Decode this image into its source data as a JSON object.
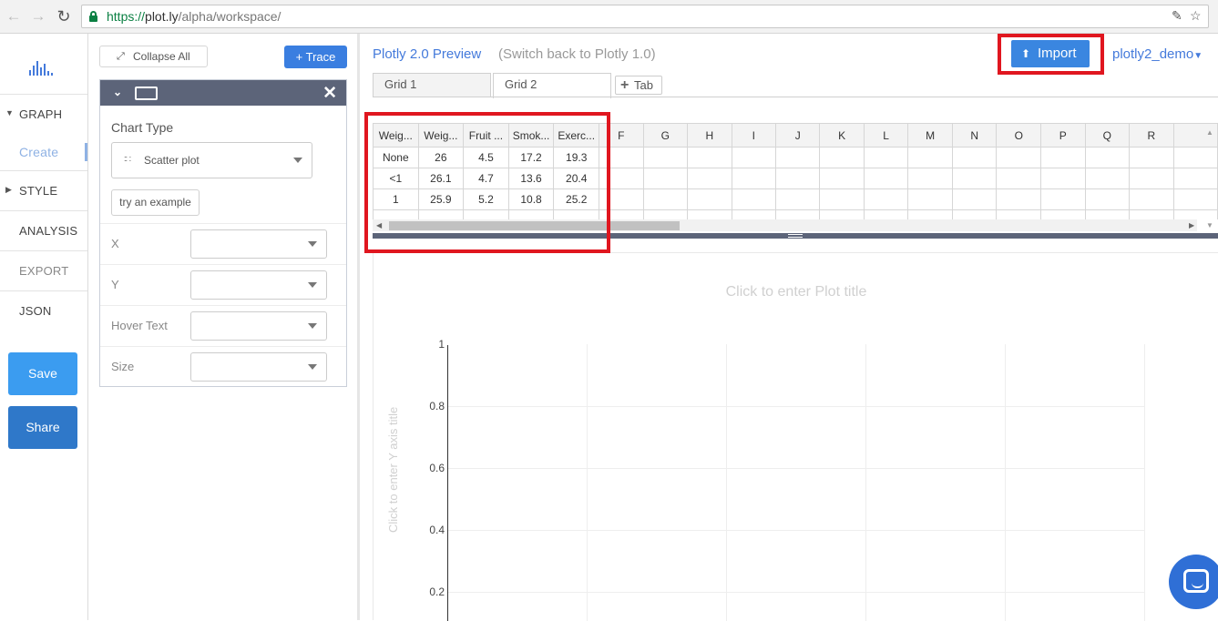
{
  "browser": {
    "url_scheme": "https://",
    "url_host": "plot.ly",
    "url_path": "/alpha/workspace/"
  },
  "leftnav": {
    "items": [
      {
        "label": "GRAPH"
      },
      {
        "label": "Create"
      },
      {
        "label": "STYLE"
      },
      {
        "label": "ANALYSIS"
      },
      {
        "label": "EXPORT"
      },
      {
        "label": "JSON"
      }
    ],
    "save_label": "Save",
    "share_label": "Share"
  },
  "panel": {
    "collapse_label": "Collapse All",
    "add_trace_label": "+ Trace",
    "chart_type_label": "Chart Type",
    "chart_type_value": "Scatter plot",
    "try_example_label": "try an example",
    "attributes": [
      {
        "label": "X",
        "value": ""
      },
      {
        "label": "Y",
        "value": ""
      },
      {
        "label": "Hover Text",
        "value": ""
      },
      {
        "label": "Size",
        "value": ""
      }
    ]
  },
  "workspace": {
    "preview_title": "Plotly 2.0 Preview",
    "switch_link": "(Switch back to Plotly 1.0)",
    "import_label": "Import",
    "user_name": "plotly2_demo",
    "tabs": [
      {
        "label": "Grid 1"
      },
      {
        "label": "Grid 2"
      }
    ],
    "add_tab_label": "Tab"
  },
  "grid": {
    "columns": [
      "Weig...",
      "Weig...",
      "Fruit ...",
      "Smok...",
      "Exerc...",
      "F",
      "G",
      "H",
      "I",
      "J",
      "K",
      "L",
      "M",
      "N",
      "O",
      "P",
      "Q",
      "R",
      ""
    ],
    "rows": [
      [
        "None",
        "26",
        "4.5",
        "17.2",
        "19.3"
      ],
      [
        "<1",
        "26.1",
        "4.7",
        "13.6",
        "20.4"
      ],
      [
        "1",
        "25.9",
        "5.2",
        "10.8",
        "25.2"
      ]
    ]
  },
  "plot": {
    "title_placeholder": "Click to enter Plot title",
    "y_title_placeholder": "Click to enter Y axis title",
    "y_ticks": [
      "1",
      "0.8",
      "0.6",
      "0.4",
      "0.2"
    ]
  },
  "colors": {
    "accent": "#447adb",
    "highlight": "#e0161f",
    "panel_header": "#5c6479"
  }
}
